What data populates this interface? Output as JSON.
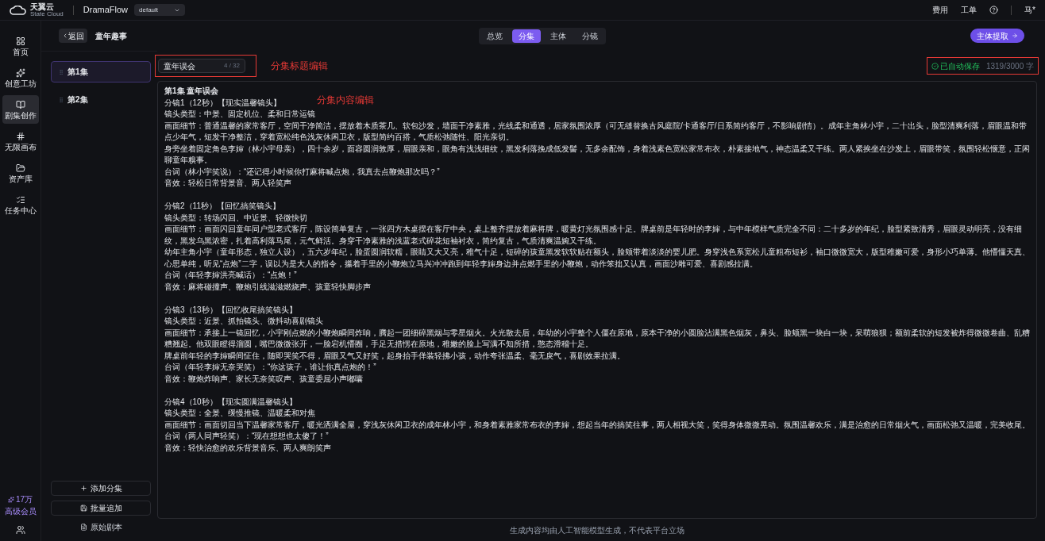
{
  "topbar": {
    "logo": {
      "name": "天翼云",
      "sub": "State Cloud"
    },
    "app": "DramaFlow",
    "workspace": "default",
    "links": [
      "费用",
      "工单"
    ],
    "user": "马*"
  },
  "nav": {
    "items": [
      {
        "label": "首页",
        "selected": false
      },
      {
        "label": "创意工坊",
        "selected": false
      },
      {
        "label": "剧集创作",
        "selected": true
      },
      {
        "label": "无限画布",
        "selected": false
      },
      {
        "label": "资产库",
        "selected": false
      },
      {
        "label": "任务中心",
        "selected": false
      }
    ],
    "credits": "17万",
    "membership": "高级会员"
  },
  "header": {
    "back": "返回",
    "title": "童年趣事",
    "tabs": [
      {
        "label": "总览",
        "selected": false
      },
      {
        "label": "分集",
        "selected": true
      },
      {
        "label": "主体",
        "selected": false
      },
      {
        "label": "分镜",
        "selected": false
      }
    ],
    "action": "主体提取"
  },
  "episodes": {
    "items": [
      {
        "label": "第1集",
        "selected": true
      },
      {
        "label": "第2集",
        "selected": false
      }
    ],
    "buttons": [
      "添加分集",
      "批量追加"
    ],
    "link": "原始剧本"
  },
  "editor": {
    "title_value": "童年误会",
    "title_count": "4 / 32",
    "saved": "已自动保存",
    "word_count": "1319/3000 字",
    "annotations": [
      "分集标题编辑",
      "分集内容编辑"
    ],
    "heading": "第1集 童年误会",
    "scenes": [
      {
        "lines": [
          "分镜1（12秒）【现实温馨镜头】",
          "镜头类型：中景、固定机位、柔和日常运镜",
          "画面细节：普通温馨的家常客厅，空间干净简洁，摆放着木质茶几、软包沙发，墙面干净素雅，光线柔和通透，居家氛围浓厚（可无缝替换古风庭院/卡通客厅/日系简约客厅，不影响剧情）。成年主角林小宇，二十出头，脸型清爽利落，眉眼温和带点少年气，短发干净整洁，穿着宽松纯色浅灰休闲卫衣，版型简约百搭，气质松弛随性、阳光亲切。",
          "身旁坐着固定角色李婶（林小宇母亲），四十余岁，面容圆润敦厚，眉眼亲和，眼角有浅浅细纹，黑发利落挽成低发髻，无多余配饰，身着浅素色宽松家常布衣，朴素接地气，神态温柔又干练。两人紧挨坐在沙发上，眉眼带笑，氛围轻松惬意，正闲聊童年糗事。",
          "台词（林小宇笑说）：“还记得小时候你打麻将喊点炮，我真去点鞭炮那次吗？”",
          "音效：轻松日常背景音、两人轻笑声"
        ]
      },
      {
        "lines": [
          "分镜2（11秒）【回忆搞笑镜头】",
          "镜头类型：转场闪回、中近景、轻微快切",
          "画面细节：画面闪回童年同户型老式客厅，陈设简单复古，一张四方木桌摆在客厅中央，桌上整齐摆放着麻将牌，暖黄灯光氛围感十足。牌桌前是年轻时的李婶，与中年模样气质完全不同：二十多岁的年纪，脸型紧致清秀，眉眼灵动明亮，没有细纹，黑发乌黑浓密，扎着高利落马尾，元气鲜活。身穿干净素雅的浅蓝老式碎花短袖衬衣，简约复古，气质清爽温婉又干练。",
          "幼年主角小宇（童年形态，独立人设），五六岁年纪，脸蛋圆润软糯，眼睛又大又亮，稚气十足，短碎的孩童黑发软软贴在额头，脸颊带着淡淡的婴儿肥。身穿浅色系宽松儿童粗布短衫，袖口微微宽大，版型稚嫩可爱，身形小巧单薄。他懵懂天真、心思单纯，听见“点炮”二字，误以为是大人的指令，攥着手里的小鞭炮立马兴冲冲跑到年轻李婶身边并点燃手里的小鞭炮，动作笨拙又认真，画面沙雕可爱、喜剧感拉满。",
          "台词（年轻李婶洪亮喊话）：“点炮！”",
          "音效：麻将碰撞声、鞭炮引线滋滋燃烧声、孩童轻快脚步声"
        ]
      },
      {
        "lines": [
          "分镜3（13秒）【回忆收尾搞笑镜头】",
          "镜头类型：近景、抓拍镜头、微抖动喜剧镜头",
          "画面细节：承接上一镜回忆，小宇刚点燃的小鞭炮瞬间炸响，腾起一团细碎黑烟与零星烟火。火光散去后，年幼的小宇整个人僵在原地，原本干净的小圆脸沾满黑色烟灰，鼻头、脸颊黑一块白一块，呆萌狼狈；额前柔软的短发被炸得微微卷曲、乱糟糟翘起。他双眼瞪得溜圆，嘴巴微微张开，一脸宕机懵圈，手足无措愣在原地，稚嫩的脸上写满不知所措，憨态滑稽十足。",
          "牌桌前年轻的李婶瞬间怔住，随即哭笑不得，眉眼又气又好笑，起身抬手佯装轻拂小孩，动作夸张温柔、毫无戾气，喜剧效果拉满。",
          "台词（年轻李婶无奈哭笑）：“你这孩子，谁让你真点炮的！”",
          "音效：鞭炮炸响声、家长无奈笑叹声、孩童委屈小声嘟囔"
        ]
      },
      {
        "lines": [
          "分镜4（10秒）【现实圆满温馨镜头】",
          "镜头类型：全景、缓慢推镜、温暖柔和对焦",
          "画面细节：画面切回当下温馨家常客厅，暖光洒满全屋，穿浅灰休闲卫衣的成年林小宇，和身着素雅家常布衣的李婶，想起当年的搞笑往事，两人相视大笑，笑得身体微微晃动。氛围温馨欢乐，满是治愈的日常烟火气，画面松弛又温暖，完美收尾。",
          "台词（两人同声轻笑）：“现在想想也太傻了！”",
          "音效：轻快治愈的欢乐背景音乐、两人爽朗笑声"
        ]
      }
    ]
  },
  "footer": "生成内容均由人工智能模型生成，不代表平台立场"
}
